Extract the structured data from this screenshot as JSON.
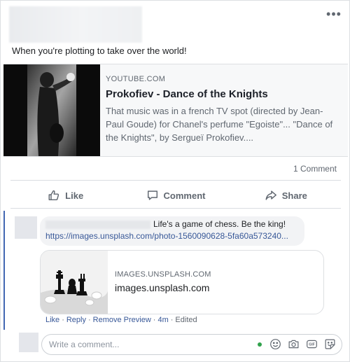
{
  "post": {
    "more_icon": "ellipsis-icon",
    "text": "When you're plotting to take over the world!",
    "link_preview": {
      "domain": "YOUTUBE.COM",
      "title": "Prokofiev - Dance of the Knights",
      "description": "That music was in a french TV spot (directed by Jean-Paul Goude) for Chanel's perfume \"Egoiste\"... \"Dance of the Knights\", by Sergueï Prokofiev...."
    },
    "comment_count": "1 Comment"
  },
  "actions": {
    "like": "Like",
    "comment": "Comment",
    "share": "Share"
  },
  "comment": {
    "text": "Life's a game of chess. Be the king!",
    "link": "https://images.unsplash.com/photo-1560090628-5fa60a573240...",
    "attachment": {
      "domain": "IMAGES.UNSPLASH.COM",
      "title": "images.unsplash.com"
    },
    "meta": {
      "like": "Like",
      "reply": "Reply",
      "remove_preview": "Remove Preview",
      "time": "4m",
      "edited": "Edited",
      "separator": "·"
    }
  },
  "write_comment": {
    "placeholder": "Write a comment...",
    "status_color": "#31a24c"
  },
  "colors": {
    "accent": "#385898",
    "comment_thread_bar": "#4267b2",
    "muted_text": "#606770"
  }
}
